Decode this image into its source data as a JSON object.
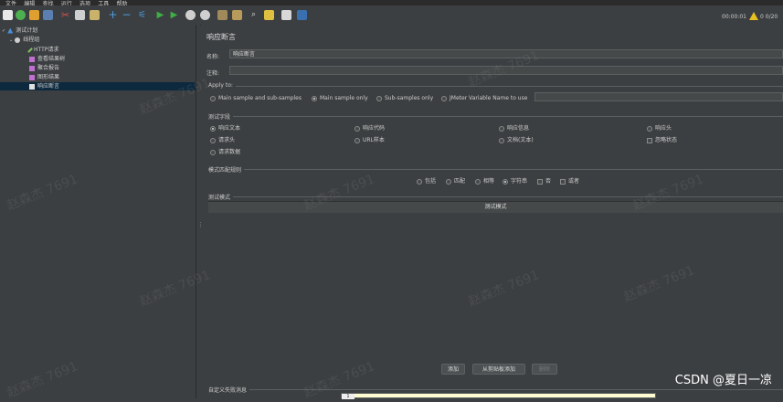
{
  "menubar": {
    "items": [
      "文件",
      "编辑",
      "查找",
      "运行",
      "选项",
      "工具",
      "帮助"
    ]
  },
  "toolbar": {
    "icons": [
      "new-icon",
      "templates-icon",
      "open-icon",
      "save-icon",
      "cut-icon",
      "copy-icon",
      "paste-icon",
      "expand-icon",
      "collapse-icon",
      "toggle-icon",
      "start-icon",
      "start-no-timers-icon",
      "stop-icon",
      "shutdown-icon",
      "clear-icon",
      "clear-all-icon",
      "search-icon",
      "reset-search-icon",
      "function-helper-icon",
      "help-icon"
    ],
    "timer": "00:00:01",
    "warning_count": "0",
    "threads": "0/20"
  },
  "tree": {
    "items": [
      {
        "label": "测试计划",
        "icon": "test-plan-icon"
      },
      {
        "label": "线程组",
        "icon": "thread-group-icon"
      },
      {
        "label": "HTTP请求",
        "icon": "http-sampler-icon"
      },
      {
        "label": "查看结果树",
        "icon": "listener-icon"
      },
      {
        "label": "聚合报告",
        "icon": "listener-icon"
      },
      {
        "label": "图形结果",
        "icon": "listener-icon"
      },
      {
        "label": "响应断言",
        "icon": "assertion-icon"
      }
    ]
  },
  "panel": {
    "title": "响应断言",
    "name_label": "名称:",
    "name_value": "响应断言",
    "comment_label": "注释:",
    "comment_value": "",
    "apply_to": {
      "title": "Apply to:",
      "options": [
        "Main sample and sub-samples",
        "Main sample only",
        "Sub-samples only",
        "JMeter Variable Name to use"
      ],
      "selected": 1
    },
    "field_to_test": {
      "title": "测试字段",
      "options": [
        "响应文本",
        "响应代码",
        "响应信息",
        "响应头",
        "请求头",
        "URL样本",
        "文档(文本)",
        "忽略状态",
        "请求数据"
      ],
      "selected": 0
    },
    "pattern_matching": {
      "title": "模式匹配规则",
      "options": [
        "包括",
        "匹配",
        "相等",
        "字符串"
      ],
      "selected": 3,
      "checkboxes": [
        "否",
        "或者"
      ]
    },
    "patterns": {
      "title": "测试模式",
      "column_header": "测试模式"
    },
    "buttons": {
      "add": "添加",
      "add_clipboard": "从剪贴板添加",
      "delete": "删除"
    },
    "custom_failure": {
      "title": "自定义失败消息",
      "line": "1"
    }
  },
  "watermarks": [
    "赵森杰 7691",
    "赵森杰 7691",
    "赵森杰 7691",
    "赵森杰 7691",
    "赵森杰 7691",
    "赵森杰 7691",
    "赵森杰 7691",
    "赵森杰 7691",
    "赵森杰 7691",
    "赵森杰 7691"
  ],
  "csdn": "CSDN @夏日一凉"
}
